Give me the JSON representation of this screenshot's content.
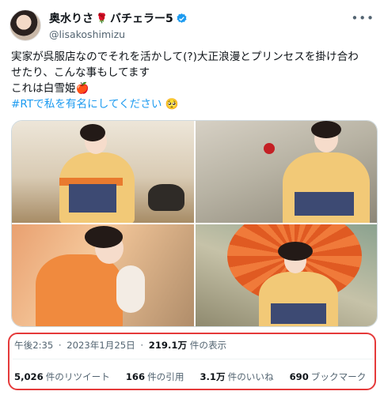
{
  "author": {
    "display_name": "奥水りさ",
    "name_suffix": "バチェラー5",
    "rose_icon": "rose-icon",
    "handle": "@lisakoshimizu",
    "verified_color": "#1d9bf0"
  },
  "more_icon": "more-icon",
  "text": {
    "line1": "実家が呉服店なのでそれを活かして(?)大正浪漫とプリンセスを掛け合わ",
    "line2": "せたり、こんな事もしてます",
    "line3": "これは白雪姫",
    "line3_emoji": "🍎",
    "line4_hashtag": "#RTで私を有名にしてください",
    "line4_emoji": "🥺"
  },
  "media": {
    "count": 4,
    "items": [
      "photo-1",
      "photo-2",
      "photo-3",
      "photo-4"
    ]
  },
  "meta": {
    "time": "午後2:35",
    "separator": "·",
    "date": "2023年1月25日",
    "views_count": "219.1万",
    "views_label": "件の表示"
  },
  "engagement": {
    "retweets_count": "5,026",
    "retweets_label": "件のリツイート",
    "quotes_count": "166",
    "quotes_label": "件の引用",
    "likes_count": "3.1万",
    "likes_label": "件のいいね",
    "bookmarks_count": "690",
    "bookmarks_label": "ブックマーク"
  },
  "colors": {
    "highlight_box": "#e53a3a",
    "link": "#1d9bf0",
    "muted_text": "#536471"
  }
}
